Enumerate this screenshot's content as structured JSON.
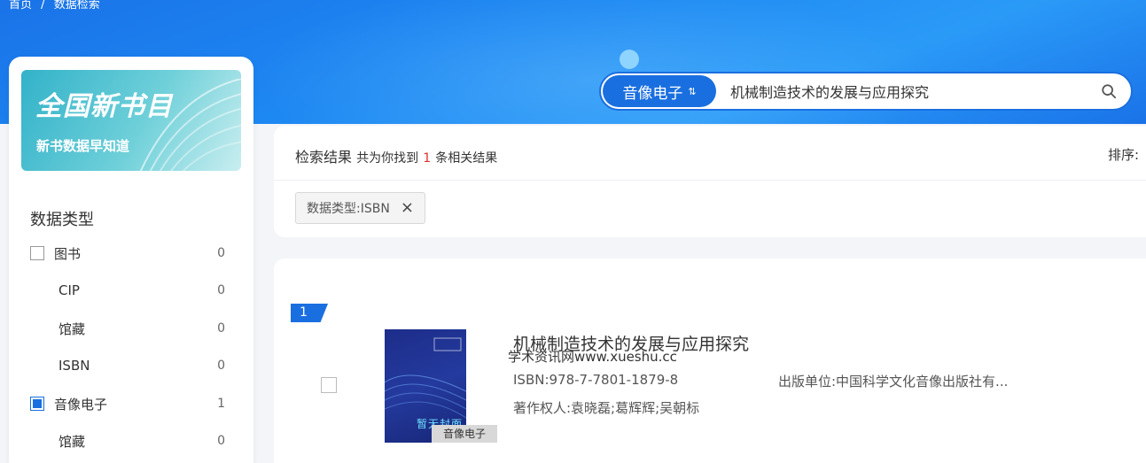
{
  "breadcrumb": {
    "home": "首页",
    "sep": "/",
    "current": "数据检索"
  },
  "search": {
    "type_label": "音像电子",
    "swap_glyph": "⇅",
    "query": "机械制造技术的发展与应用探究"
  },
  "promo": {
    "logo_text": "全国新书目",
    "tagline": "新书数据早知道"
  },
  "filters": {
    "title": "数据类型",
    "items": [
      {
        "label": "图书",
        "count": "0",
        "checked": false,
        "sub": false
      },
      {
        "label": "CIP",
        "count": "0",
        "sub": true
      },
      {
        "label": "馆藏",
        "count": "0",
        "sub": true
      },
      {
        "label": "ISBN",
        "count": "0",
        "sub": true
      },
      {
        "label": "音像电子",
        "count": "1",
        "checked": true,
        "sub": false
      },
      {
        "label": "馆藏",
        "count": "0",
        "sub": true
      }
    ]
  },
  "results": {
    "title": "检索结果",
    "prefix": "共为你找到",
    "count": "1",
    "suffix": "条相关结果",
    "sort_label": "排序:",
    "active_tag": "数据类型:ISBN",
    "close_glyph": "×"
  },
  "items": [
    {
      "rank": "1",
      "title": "机械制造技术的发展与应用探究",
      "watermark": "学术资讯网www.xueshu.cc",
      "isbn": "ISBN:978-7-7801-1879-8",
      "publisher": "出版单位:中国科学文化音像出版社有...",
      "authors": "著作权人:袁晓磊;葛辉辉;吴朝标",
      "cover_text": "暂无封面",
      "badge": "音像电子"
    }
  ],
  "colors": {
    "primary": "#1a6fe0",
    "accent_red": "#e0312b"
  }
}
